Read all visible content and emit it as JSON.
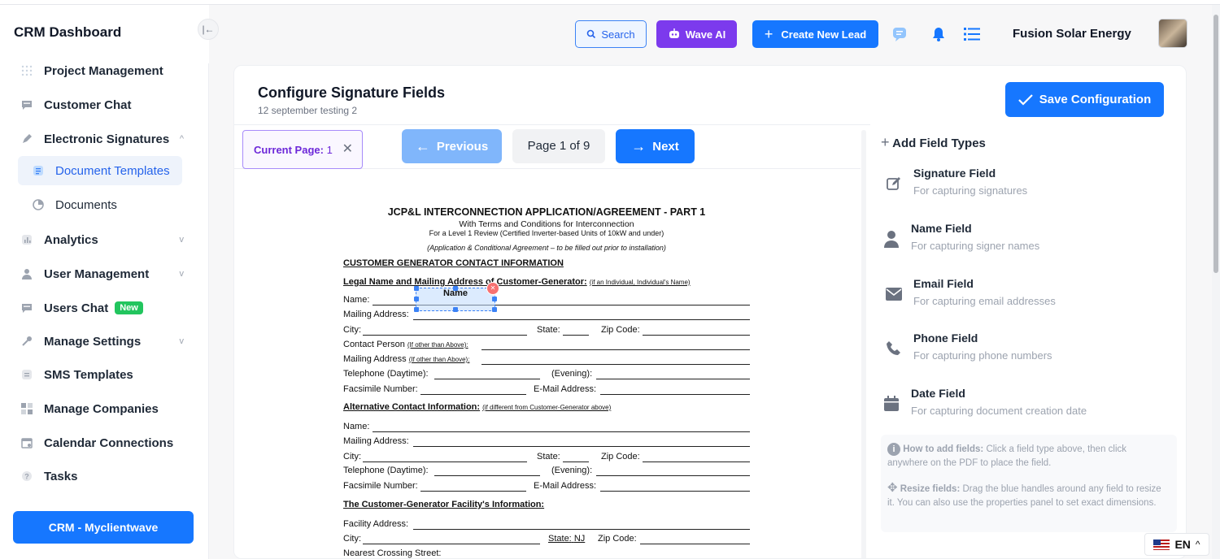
{
  "app": {
    "title": "CRM Dashboard"
  },
  "sidebar": {
    "items": [
      {
        "label": "Project Management"
      },
      {
        "label": "Customer Chat"
      },
      {
        "label": "Electronic Signatures"
      },
      {
        "label": "Document Templates"
      },
      {
        "label": "Documents"
      },
      {
        "label": "Analytics"
      },
      {
        "label": "User Management"
      },
      {
        "label": "Users Chat",
        "badge": "New"
      },
      {
        "label": "Manage Settings"
      },
      {
        "label": "SMS Templates"
      },
      {
        "label": "Manage Companies"
      },
      {
        "label": "Calendar Connections"
      },
      {
        "label": "Tasks"
      }
    ],
    "footer_button": "CRM - Myclientwave"
  },
  "header": {
    "search_label": "Search",
    "wave_label": "Wave AI",
    "create_label": "Create New Lead",
    "company": "Fusion Solar Energy",
    "colors": {
      "primary": "#1677ff",
      "wave": "#7c3aed"
    }
  },
  "page": {
    "title": "Configure Signature Fields",
    "subtitle": "12 september testing 2",
    "save_label": "Save Configuration"
  },
  "viewer": {
    "current_page_label": "Current Page:",
    "current_page_value": "1",
    "prev_label": "Previous",
    "page_indicator": "Page 1 of 9",
    "next_label": "Next"
  },
  "pdf": {
    "title": "JCP&L INTERCONNECTION APPLICATION/AGREEMENT - PART 1",
    "subtitle": "With Terms and Conditions for Interconnection",
    "subtitle2": "For a Level 1 Review (Certified Inverter-based Units of 10kW and under)",
    "note": "(Application & Conditional Agreement – to be filled out prior to installation)",
    "section1": "CUSTOMER GENERATOR CONTACT INFORMATION",
    "legal": "Legal Name and Mailing Address of Customer-Generator:",
    "legal_note": "(if an Individual, Individual's Name)",
    "name": "Name:",
    "mailing": "Mailing Address:",
    "city": "City:",
    "state": "State:",
    "zip": "Zip Code:",
    "contact_person": "Contact Person",
    "contact_note": "(If other than Above):",
    "mailing2": "Mailing Address",
    "mailing2_note": "(If other than Above):",
    "telephone": "Telephone (Daytime):",
    "evening": "(Evening):",
    "fax": "Facsimile Number:",
    "email": "E-Mail Address:",
    "alt": "Alternative Contact Information:",
    "alt_note": "(if different from Customer-Generator above)",
    "name2": "Name:",
    "mailing3": "Mailing Address:",
    "city2": "City:",
    "state2": "State:",
    "zip2": "Zip Code:",
    "telephone2": "Telephone (Daytime):",
    "evening2": "(Evening):",
    "fax2": "Facsimile Number:",
    "email2": "E-Mail Address:",
    "facility": "The Customer-Generator Facility's Information:",
    "facility_addr": "Facility Address:",
    "city3": "City:",
    "state3": "State:",
    "state3_val": "NJ",
    "zip3": "Zip Code:",
    "crossing": "Nearest Crossing Street:",
    "placed_field": "Name"
  },
  "panel": {
    "title": "Add Field Types",
    "fields": [
      {
        "name": "Signature Field",
        "desc": "For capturing signatures",
        "icon": "edit-icon"
      },
      {
        "name": "Name Field",
        "desc": "For capturing signer names",
        "icon": "user-icon"
      },
      {
        "name": "Email Field",
        "desc": "For capturing email addresses",
        "icon": "mail-icon"
      },
      {
        "name": "Phone Field",
        "desc": "For capturing phone numbers",
        "icon": "phone-icon"
      },
      {
        "name": "Date Field",
        "desc": "For capturing document creation date",
        "icon": "calendar-icon"
      }
    ],
    "help_add_title": "How to add fields:",
    "help_add_text": "Click a field type above, then click anywhere on the PDF to place the field.",
    "help_resize_title": "Resize fields:",
    "help_resize_text": "Drag the blue handles around any field to resize it. You can also use the properties panel to set exact dimensions."
  },
  "lang": {
    "code": "EN"
  }
}
